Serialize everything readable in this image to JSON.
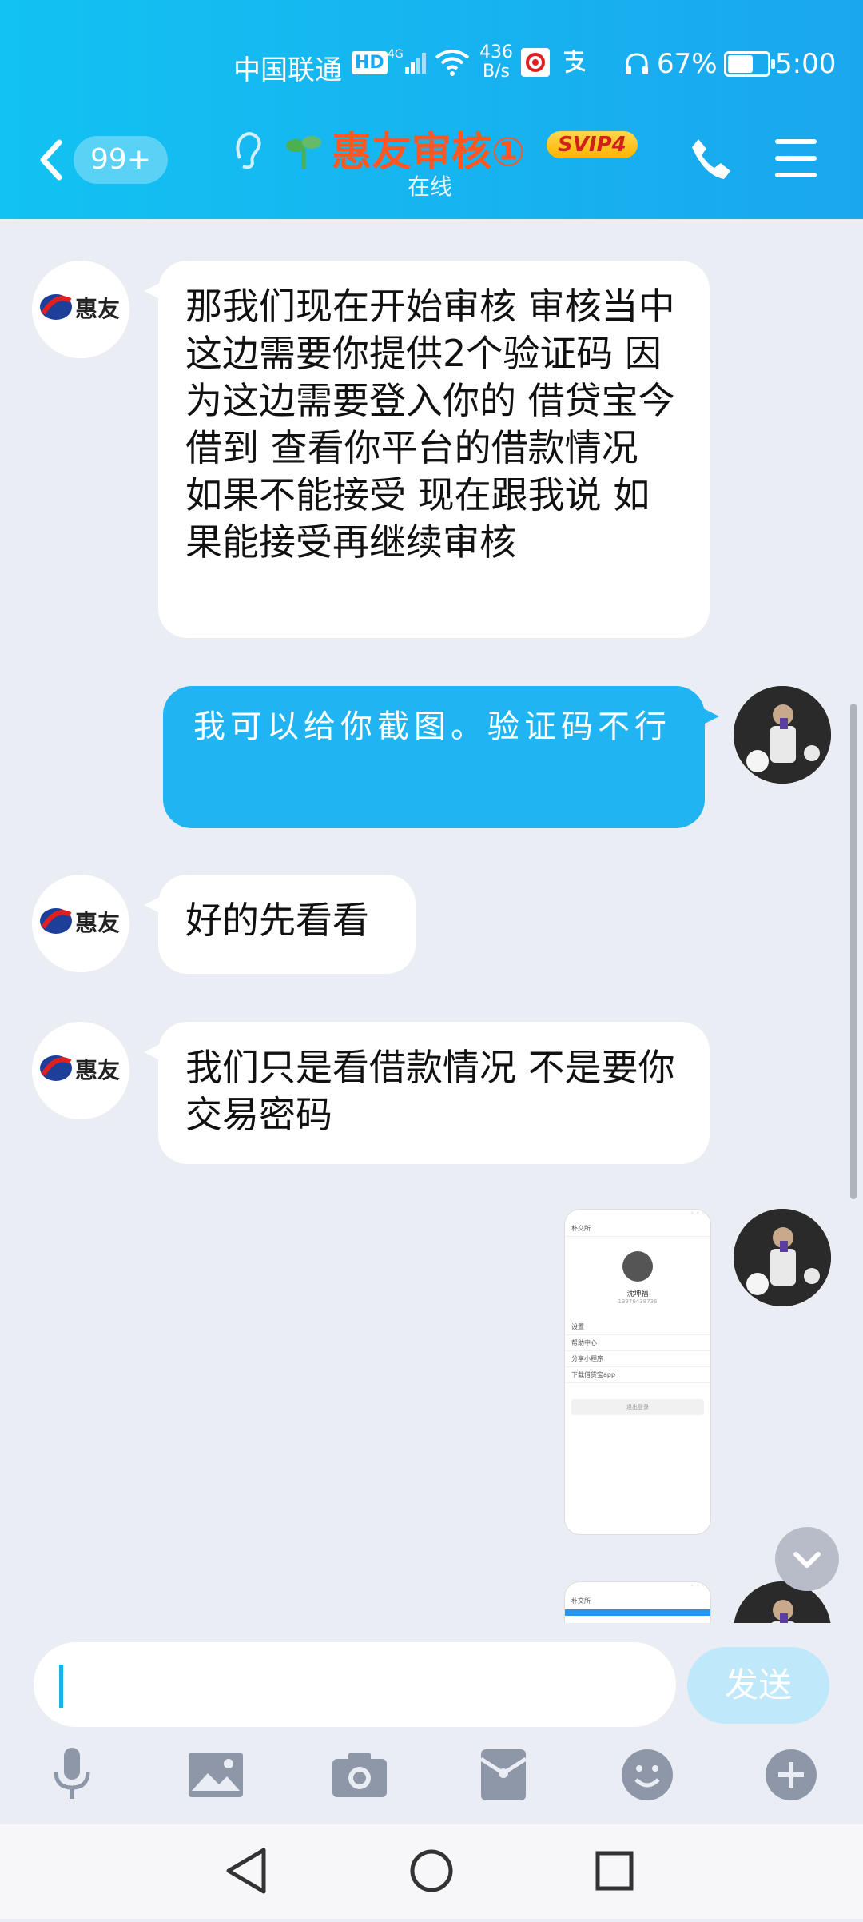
{
  "status_bar": {
    "carrier": "中国联通",
    "hd": "HD",
    "network": "4G",
    "speed_value": "436",
    "speed_unit": "B/s",
    "battery": "67%",
    "battery_level": 0.67,
    "time": "5:00"
  },
  "header": {
    "unread_count": "99+",
    "title": "惠友审核①",
    "vip_badge": "SVIP4",
    "subtitle": "在线"
  },
  "messages": [
    {
      "side": "left",
      "sender_logo": "惠友",
      "text": " 那我们现在开始审核 审核当中这边需要你提供2个验证码  因为这边需要登入你的 借贷宝今借到 查看你平台的借款情况 如果不能接受 现在跟我说  如果能接受再继续审核"
    },
    {
      "side": "right",
      "text": "我可以给你截图。验证码不行"
    },
    {
      "side": "left",
      "sender_logo": "惠友",
      "text": "好的先看看"
    },
    {
      "side": "left",
      "sender_logo": "惠友",
      "text": "我们只是看借款情况 不是要你交易密码"
    }
  ],
  "screenshot_preview": {
    "header": "朴交所",
    "name": "沈坤福",
    "phone": "13976438736",
    "rows": [
      "设置",
      "帮助中心",
      "分享小程序",
      "下载借贷宝app"
    ],
    "button": "退出登录"
  },
  "composer": {
    "send_label": "发送"
  },
  "colors": {
    "header_gradient_start": "#12c2f2",
    "header_gradient_end": "#1aa7ee",
    "outgoing_bubble": "#21b4f3",
    "title_color": "#ff5722",
    "background": "#eaedf4"
  },
  "icons": {
    "back": "back-icon",
    "ear": "ear-icon",
    "sprout": "sprout-icon",
    "phone": "phone-icon",
    "menu": "menu-icon",
    "mic": "mic-icon",
    "image": "image-icon",
    "camera": "camera-icon",
    "red_packet": "red-packet-icon",
    "emoji": "emoji-icon",
    "plus": "plus-icon"
  }
}
